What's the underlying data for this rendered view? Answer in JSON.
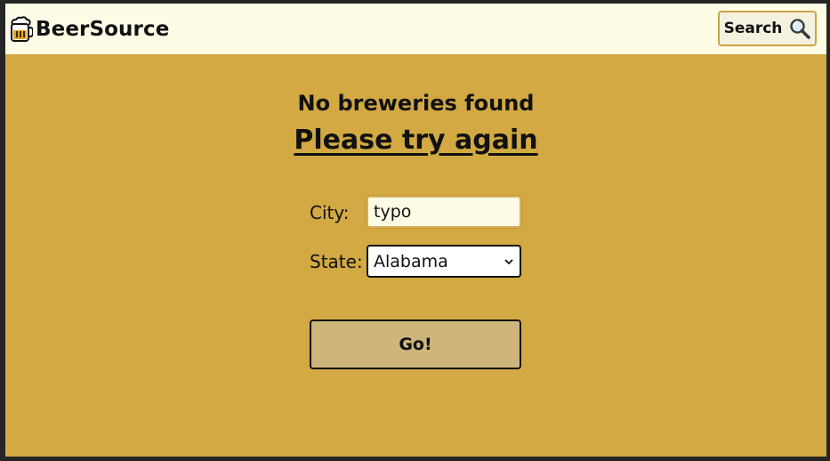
{
  "navbar": {
    "brand_name": "BeerSource",
    "brand_icon": "beer-mug-icon",
    "search_label": "Search",
    "search_icon": "magnifier-icon"
  },
  "message": {
    "title": "No breweries found",
    "retry": "Please try again"
  },
  "form": {
    "city_label": "City:",
    "city_value": "typo",
    "state_label": "State:",
    "state_selected": "Alabama",
    "submit_label": "Go!"
  },
  "colors": {
    "page_background": "#d2a942",
    "navbar_background": "#fffce6",
    "go_button": "#cdb57b"
  }
}
